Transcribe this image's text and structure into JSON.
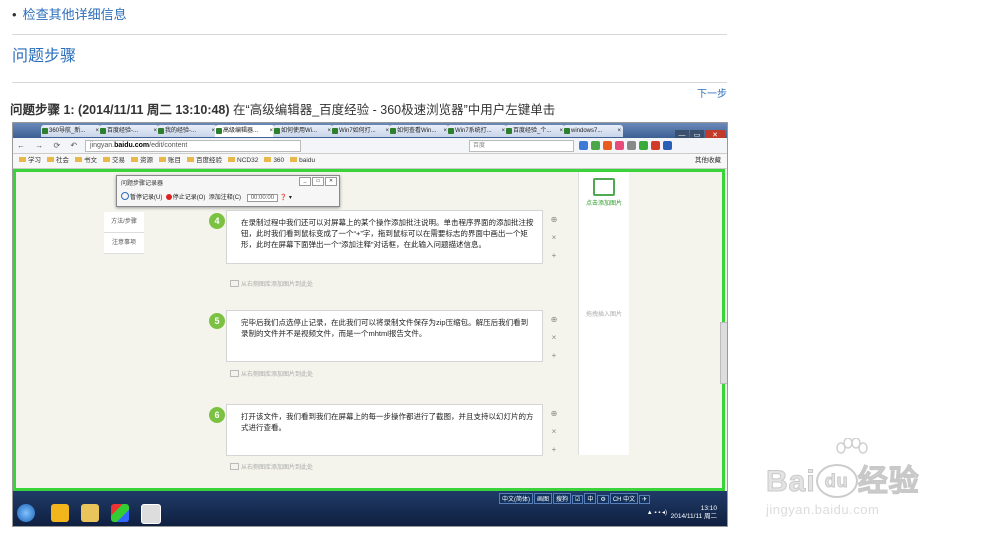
{
  "top_link": {
    "bullet": "•",
    "text": "检查其他详细信息"
  },
  "section_title": "问题步骤",
  "next_step": "下一步",
  "step": {
    "label": "问题步骤 1: (2014/11/11 周二 13:10:48)",
    "desc": " 在“高级编辑器_百度经验 - 360极速浏览器”中用户左键单击"
  },
  "screenshot": {
    "tabs": [
      "360导航_新...",
      "百度经验-...",
      "我的经验-...",
      "高级编辑器...",
      "如何使用Wi...",
      "Win7如何打...",
      "如何查看Win...",
      "Win7系统打...",
      "百度经验_个...",
      "windows7..."
    ],
    "window_buttons": [
      "—",
      "▭",
      "✕"
    ],
    "nav_icons": "← → ⟳ ↶ ☆",
    "address_prefix": "jingyan.",
    "address_host": "baidu.com",
    "address_path": "/edit/content",
    "search_placeholder": "百度",
    "bookmarks": [
      "学习",
      "社会",
      "书文",
      "交易",
      "资源",
      "账目",
      "百度经验",
      "NCD32",
      "360",
      "baidu"
    ],
    "bookmarks_right": "其他收藏",
    "recorder": {
      "title": "问题步骤记录器",
      "buttons": [
        "_",
        "▭",
        "✕"
      ],
      "pause": "暂停记录(U)",
      "stop": "停止记录(O)",
      "comment": "添加注释(C)",
      "timer": "00:00:00",
      "help": "❓ ▾"
    },
    "left_nav": [
      "方法/步骤",
      "注意事项"
    ],
    "steps": [
      {
        "num": "4",
        "text": "在录制过程中我们还可以对屏幕上的某个操作添加批注说明。单击程序界面的添加批注按钮，此时我们看到鼠标变成了一个“+”字，拖到鼠标可以在需要标志的界面中画出一个矩形，此时在屏幕下面弹出一个“添加注释”对话框，在此输入问题描述信息。"
      },
      {
        "num": "5",
        "text": "完毕后我们点选停止记录，在此我们可以将录制文件保存为zip压缩包。解压后我们看到录制的文件并不是视频文件，而是一个mhtml报告文件。"
      },
      {
        "num": "6",
        "text": "打开该文件，我们看到我们在屏幕上的每一步操作都进行了截图，并且支持以幻灯片的方式进行查看。"
      }
    ],
    "side_ops": [
      "⊕",
      "×",
      "+"
    ],
    "add_image_hint": "从右侧图库添加图片到此处",
    "right_panel_top": "点击添加图片",
    "right_panel_mid": "拖拽插入图片",
    "clock_time": "13:10",
    "clock_date": "2014/11/11 周二",
    "lang_items": [
      "中文(简体)",
      "画图",
      "搜狗",
      "☑",
      "中",
      "⚙",
      "CH 中文",
      "✈"
    ]
  },
  "watermark": {
    "word": "Bai",
    "word2": "经验",
    "logo_text": "du",
    "sub": "jingyan.baidu.com"
  },
  "colors": {
    "link": "#2a6ebb",
    "green_frame": "#39d43a",
    "badge": "#7bc142"
  }
}
